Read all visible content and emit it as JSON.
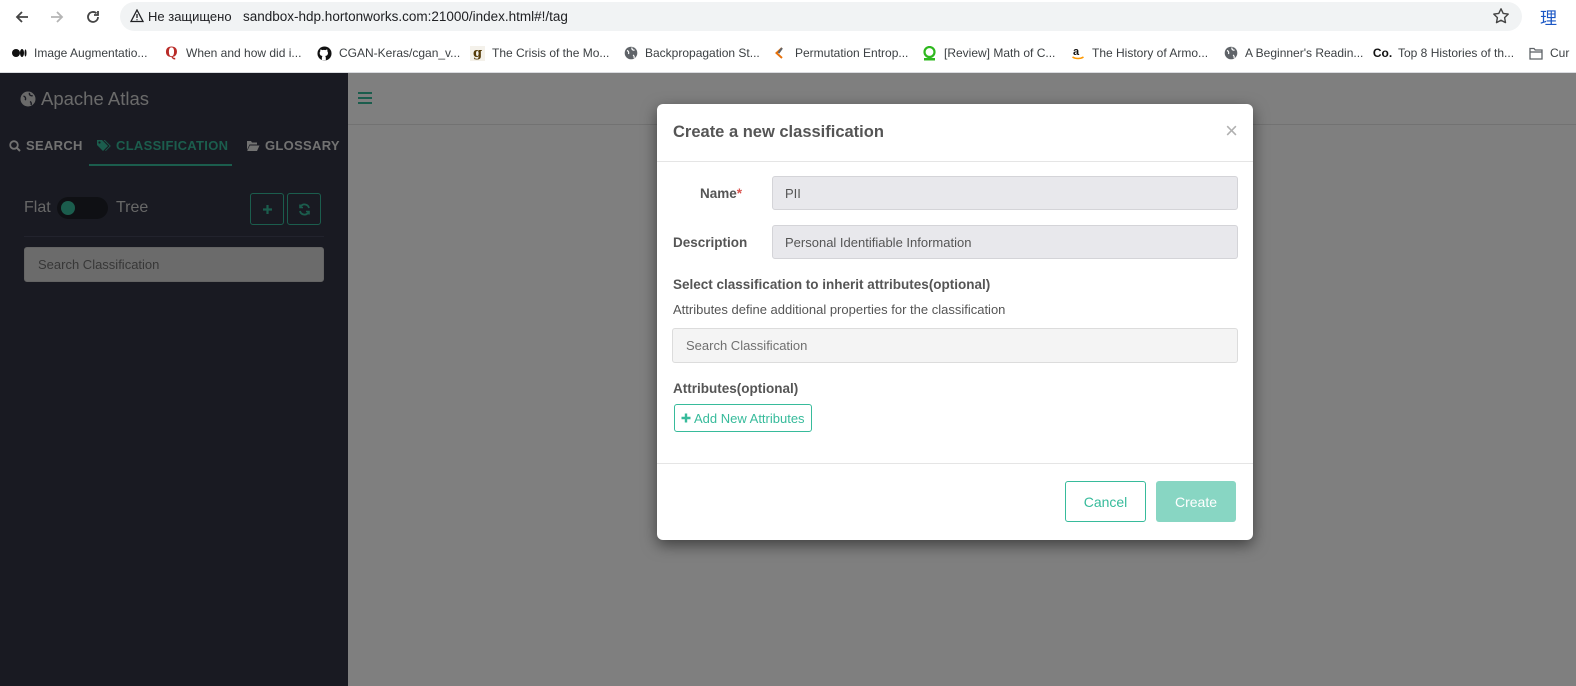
{
  "browser": {
    "security_label": "Не защищено",
    "url": "sandbox-hdp.hortonworks.com:21000/index.html#!/tag",
    "extension_glyph": "理",
    "bookmarks": [
      {
        "label": "Image Augmentatio...",
        "icon": "medium-icon"
      },
      {
        "label": "When and how did i...",
        "icon": "quora-icon"
      },
      {
        "label": "CGAN-Keras/cgan_v...",
        "icon": "github-icon"
      },
      {
        "label": "The Crisis of the Mo...",
        "icon": "goodreads-icon"
      },
      {
        "label": "Backpropagation St...",
        "icon": "globe-icon"
      },
      {
        "label": "Permutation Entrop...",
        "icon": "code-icon"
      },
      {
        "label": "[Review] Math of C...",
        "icon": "bookmark-icon"
      },
      {
        "label": "The History of Armo...",
        "icon": "amazon-icon"
      },
      {
        "label": "A Beginner's Readin...",
        "icon": "globe-icon"
      },
      {
        "label": "Top 8 Histories of th...",
        "icon": "co-icon"
      },
      {
        "label": "Cur",
        "icon": "folder-icon"
      }
    ]
  },
  "app": {
    "brand": "Apache Atlas",
    "tabs": [
      {
        "label": "SEARCH",
        "icon": "search-icon"
      },
      {
        "label": "CLASSIFICATION",
        "icon": "tags-icon",
        "active": true
      },
      {
        "label": "GLOSSARY",
        "icon": "folder-open-icon"
      }
    ],
    "toggle": {
      "left_label": "Flat",
      "right_label": "Tree"
    },
    "search_placeholder": "Search Classification"
  },
  "modal": {
    "title": "Create a new classification",
    "close_glyph": "×",
    "name_label": "Name",
    "required_mark": "*",
    "name_value": "PII",
    "description_label": "Description",
    "description_value": "Personal Identifiable Information",
    "inherit_title": "Select classification to inherit attributes(optional)",
    "inherit_help": "Attributes define additional properties for the classification",
    "inherit_placeholder": "Search Classification",
    "attributes_title": "Attributes(optional)",
    "add_attributes_label": "Add New Attributes",
    "cancel_label": "Cancel",
    "create_label": "Create"
  },
  "colors": {
    "accent": "#37bb9b",
    "sidebar_bg": "#323544",
    "create_disabled": "#88d6c3",
    "required": "#d9534f"
  }
}
